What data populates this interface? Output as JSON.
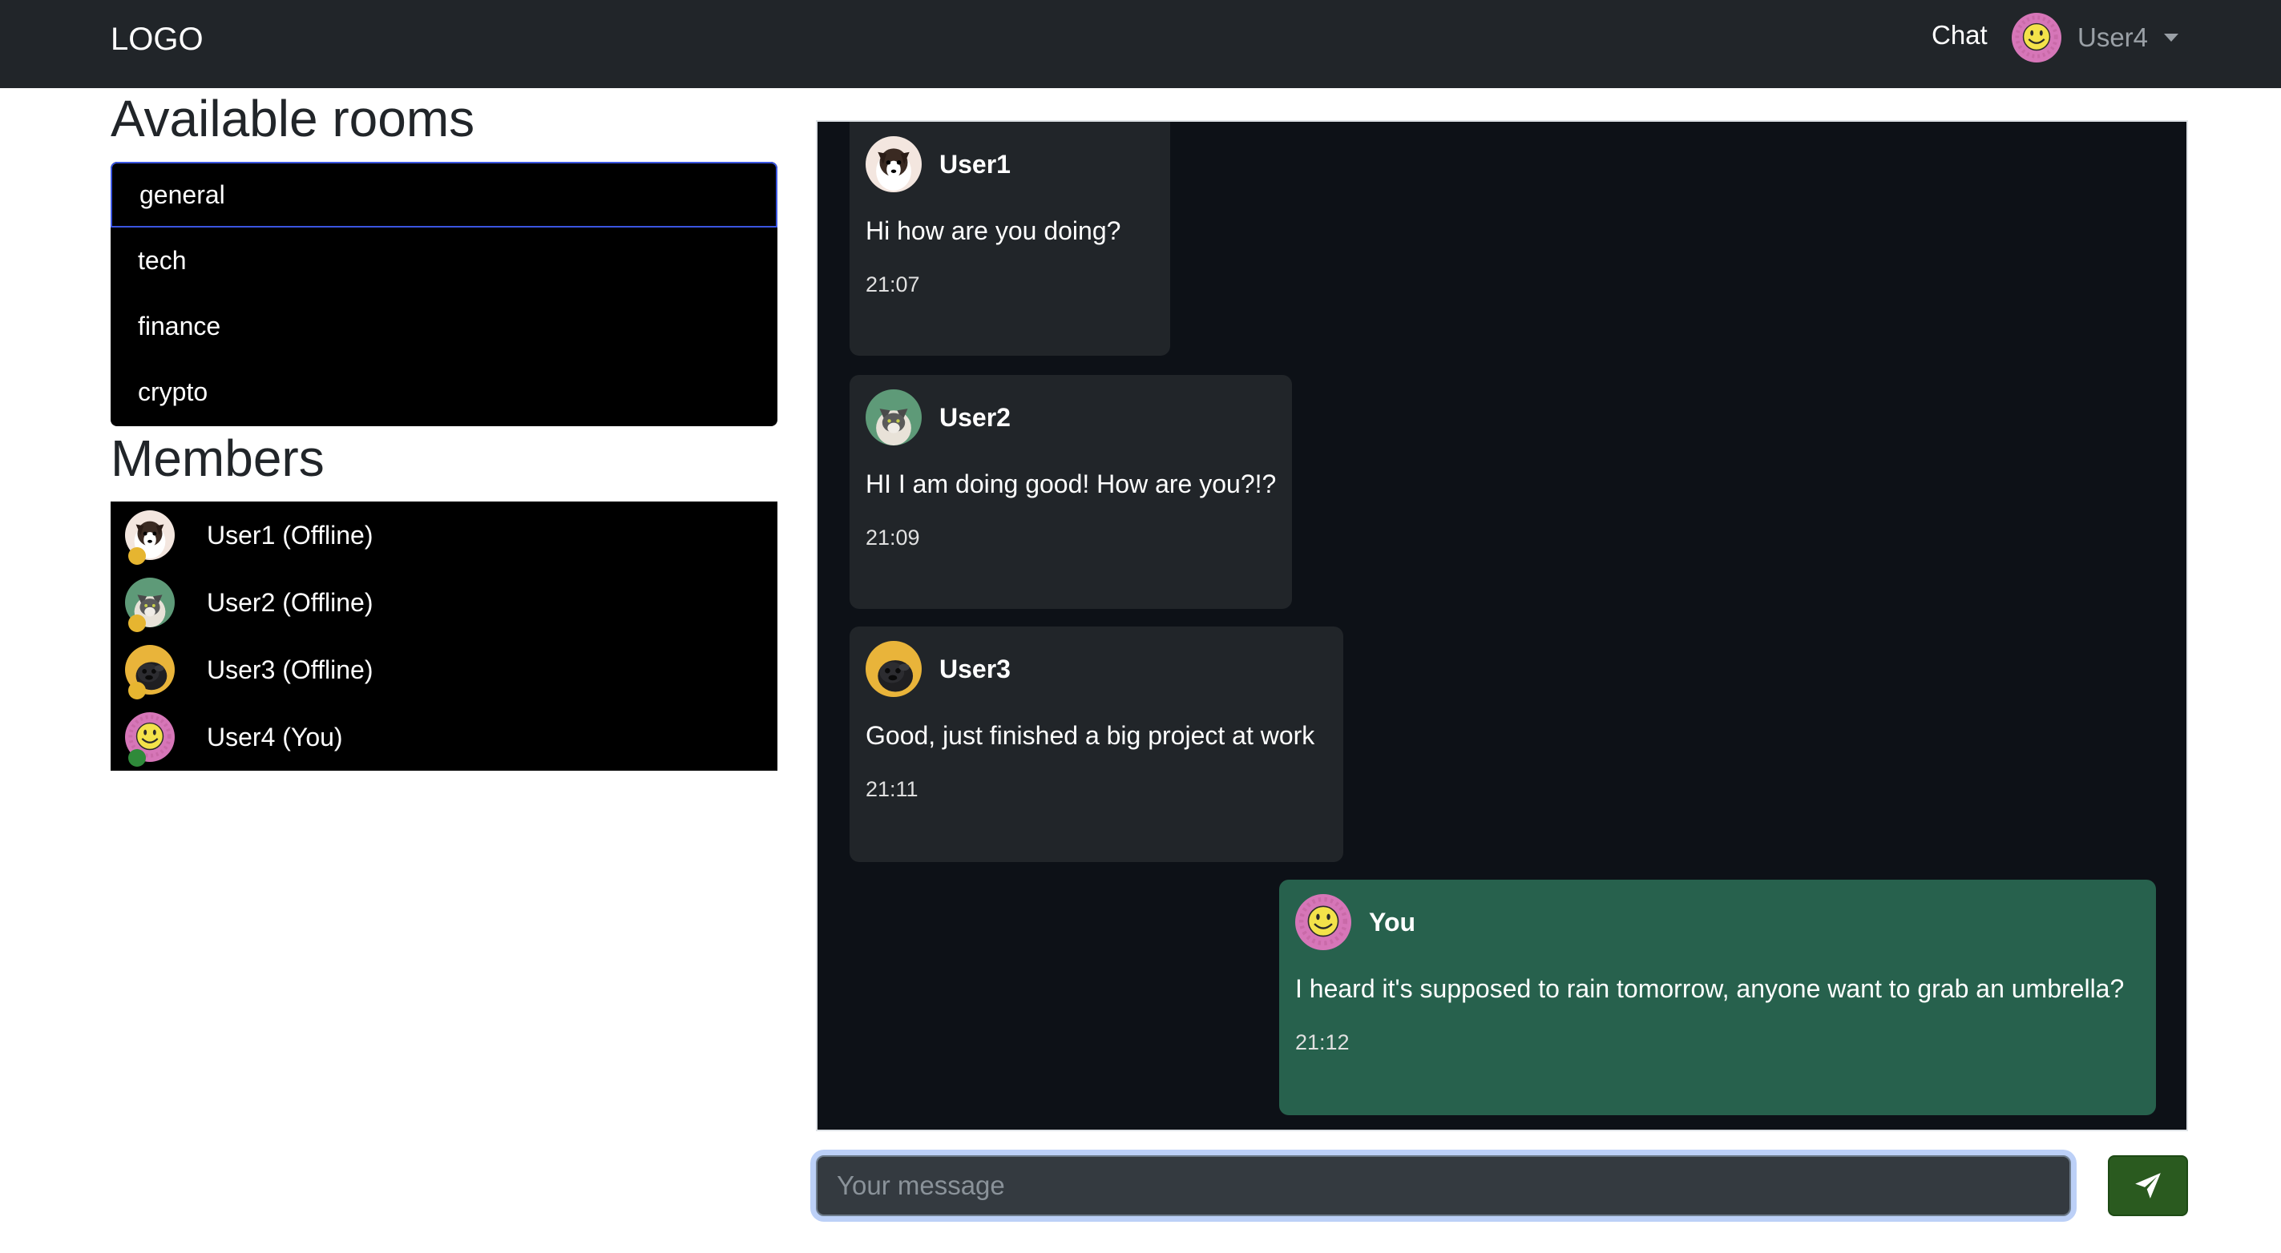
{
  "navbar": {
    "logo": "LOGO",
    "chat_link": "Chat",
    "user_name": "User4"
  },
  "rooms": {
    "title": "Available rooms",
    "items": [
      {
        "label": "general",
        "active": true
      },
      {
        "label": "tech"
      },
      {
        "label": "finance"
      },
      {
        "label": "crypto"
      }
    ]
  },
  "members": {
    "title": "Members",
    "items": [
      {
        "label": "User1 (Offline)",
        "status": "offline",
        "avatar": "dog-avatar"
      },
      {
        "label": "User2 (Offline)",
        "status": "offline",
        "avatar": "cat-avatar"
      },
      {
        "label": "User3 (Offline)",
        "status": "offline",
        "avatar": "pug-avatar"
      },
      {
        "label": "User4 (You)",
        "status": "online",
        "avatar": "smiley-avatar"
      }
    ]
  },
  "messages": [
    {
      "author": "User1",
      "text": "Hi how are you doing?",
      "time": "21:07",
      "avatar": "dog-avatar"
    },
    {
      "author": "User2",
      "text": "HI I am doing good! How are you?!?",
      "time": "21:09",
      "avatar": "cat-avatar"
    },
    {
      "author": "User3",
      "text": "Good, just finished a big project at work",
      "time": "21:11",
      "avatar": "pug-avatar"
    },
    {
      "author": "You",
      "text": "I heard it's supposed to rain tomorrow, anyone want to grab an umbrella?",
      "time": "21:12",
      "avatar": "smiley-avatar",
      "mine": true
    }
  ],
  "composer": {
    "placeholder": "Your message",
    "send_icon": "paper-plane-icon"
  },
  "colors": {
    "navbar": "#212529",
    "status_offline": "#e6b530",
    "status_online": "#2f8a3a",
    "own_message": "#27614d",
    "other_message": "#212529",
    "send_button": "#2a5a1f"
  }
}
